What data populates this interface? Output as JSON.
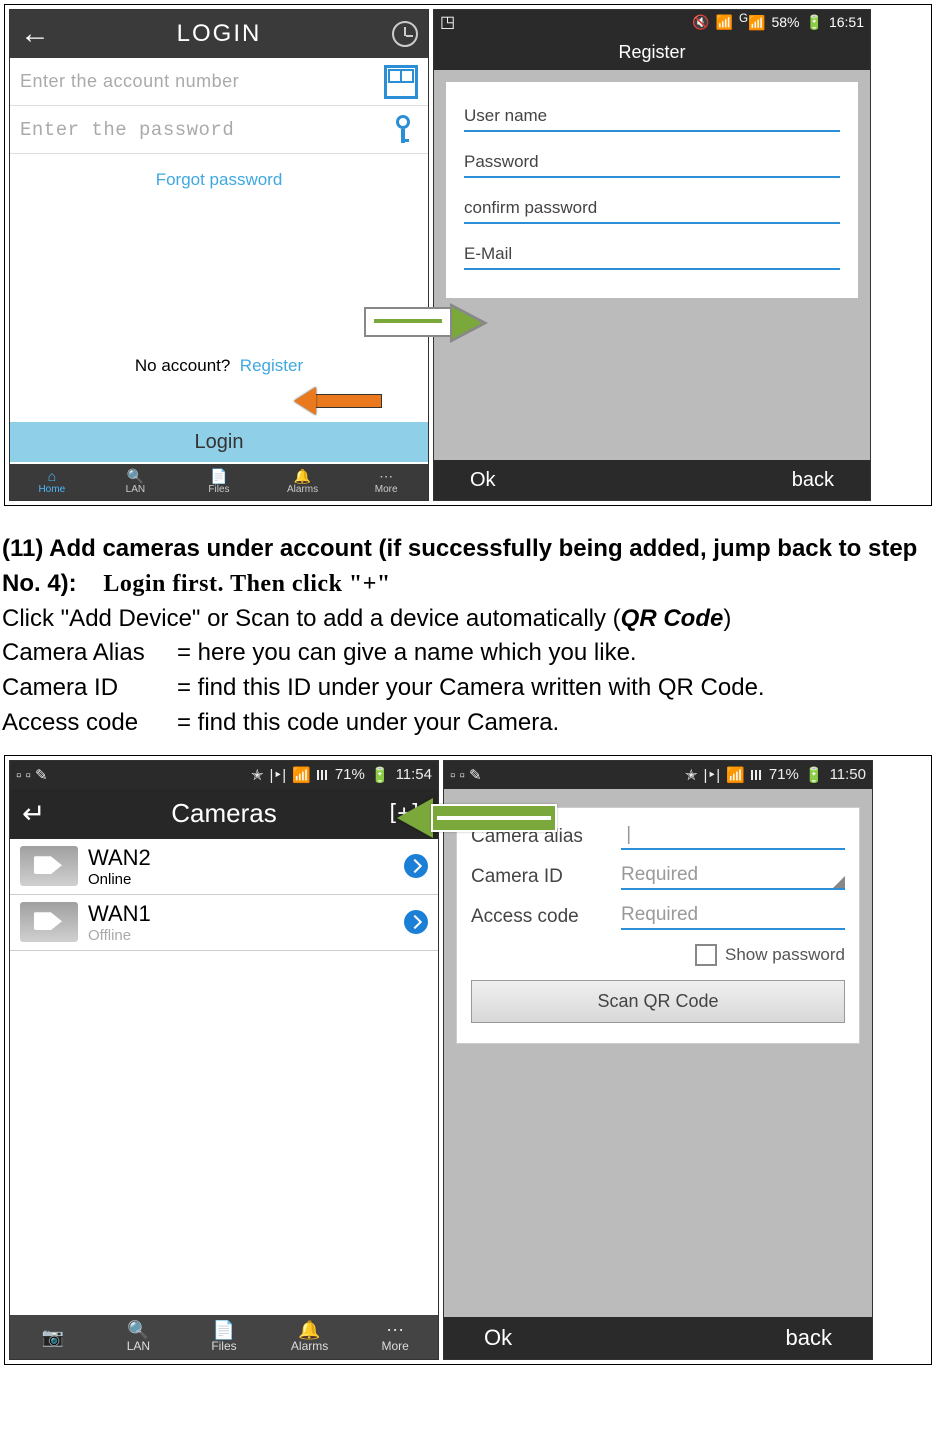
{
  "fig1": {
    "login": {
      "title": "LOGIN",
      "account_ph": "Enter the account number",
      "pwd_ph": "Enter the password",
      "forgot": "Forgot password",
      "noacct": "No account?",
      "register": "Register",
      "login_btn": "Login",
      "nav": [
        "Home",
        "LAN",
        "Files",
        "Alarms",
        "More"
      ]
    },
    "register": {
      "status": {
        "battery": "58%",
        "time": "16:51",
        "net": "G"
      },
      "title": "Register",
      "fields": [
        "User name",
        "Password",
        "confirm password",
        "E-Mail"
      ],
      "ok": "Ok",
      "back": "back"
    }
  },
  "text": {
    "step_prefix": "(11) Add cameras under account (if successfully being added, jump back to step No. 4):",
    "step_emph": "Login first. Then click \"+\"",
    "instr": "Click \"Add Device\" or Scan to add a device automatically (",
    "qr": "QR Code",
    "instr2": ")",
    "defs": [
      {
        "lbl": "Camera Alias",
        "val": "= here you can give a name which you like."
      },
      {
        "lbl": "Camera ID",
        "val": "= find this ID under your Camera written with QR Code."
      },
      {
        "lbl": "Access code",
        "val": "= find this code under your Camera."
      }
    ]
  },
  "fig2": {
    "cameras": {
      "status": {
        "battery": "71%",
        "time": "11:54"
      },
      "title": "Cameras",
      "list": [
        {
          "name": "WAN2",
          "status": "Online"
        },
        {
          "name": "WAN1",
          "status": "Offline"
        }
      ],
      "nav": [
        "",
        "LAN",
        "Files",
        "Alarms",
        "More"
      ]
    },
    "add": {
      "status": {
        "battery": "71%",
        "time": "11:50"
      },
      "alias_lbl": "Camera alias",
      "id_lbl": "Camera ID",
      "id_ph": "Required",
      "code_lbl": "Access code",
      "code_ph": "Required",
      "show": "Show password",
      "scan": "Scan QR Code",
      "ok": "Ok",
      "back": "back"
    }
  }
}
